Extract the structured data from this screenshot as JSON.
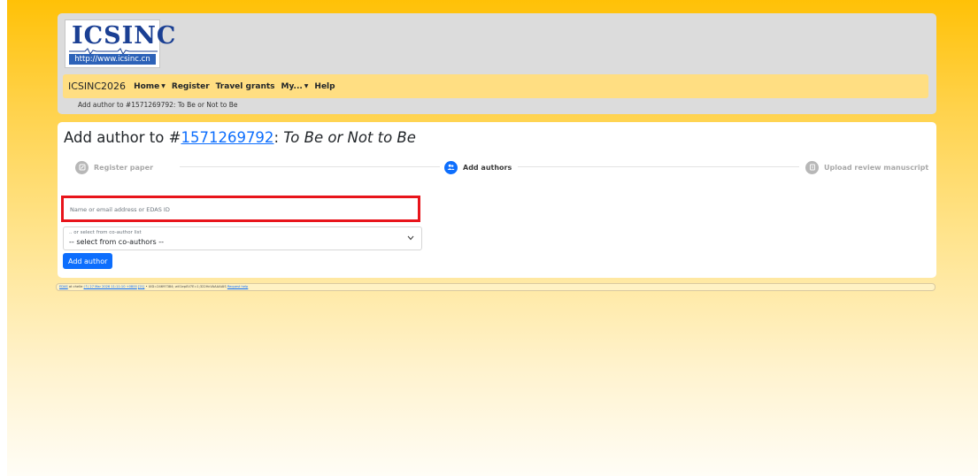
{
  "logo": {
    "text": "ICSINC",
    "url": "http://www.icsinc.cn"
  },
  "navbar": {
    "brand": "ICSINC2026",
    "items": [
      {
        "label": "Home",
        "dropdown": true
      },
      {
        "label": "Register",
        "dropdown": false
      },
      {
        "label": "Travel grants",
        "dropdown": false
      },
      {
        "label": "My...",
        "dropdown": true
      },
      {
        "label": "Help",
        "dropdown": false
      }
    ]
  },
  "breadcrumb": "Add author to #1571269792: To Be or Not to Be",
  "page": {
    "title_prefix": "Add author to #",
    "paper_id": "1571269792",
    "title_separator": ": ",
    "paper_title": "To Be or Not to Be"
  },
  "stepper": {
    "steps": [
      {
        "label": "Register paper",
        "state": "inactive",
        "icon": "pen-icon"
      },
      {
        "label": "Add authors",
        "state": "active",
        "icon": "users-icon"
      },
      {
        "label": "Upload review manuscript",
        "state": "inactive",
        "icon": "upload-icon"
      }
    ]
  },
  "form": {
    "author_input_placeholder": "Name or email address or EDAS ID",
    "author_input_value": "",
    "coauthor_caption": ".. or select from co-author list",
    "coauthor_selected": "-- select from co-authors --",
    "add_button": "Add author"
  },
  "footer": {
    "edas_link": "EDAS",
    "host_text": " at ",
    "host": "chelle",
    "timestamp_link": "(↑) 27 Mar 2026 11:11:10 +0800",
    "timing_link": "[21]",
    "session_text": " • UID=24697384; wV1ep0V7E=1;322HcVAAAAAIS",
    "request_help_link": "Request help"
  },
  "colors": {
    "background_top": "#ffc107",
    "header_bg": "#dcdcdc",
    "navbar_bg": "#ffde82",
    "primary": "#0d6efd",
    "highlight_border": "#e8141b",
    "logo_blue": "#1a3f93"
  }
}
